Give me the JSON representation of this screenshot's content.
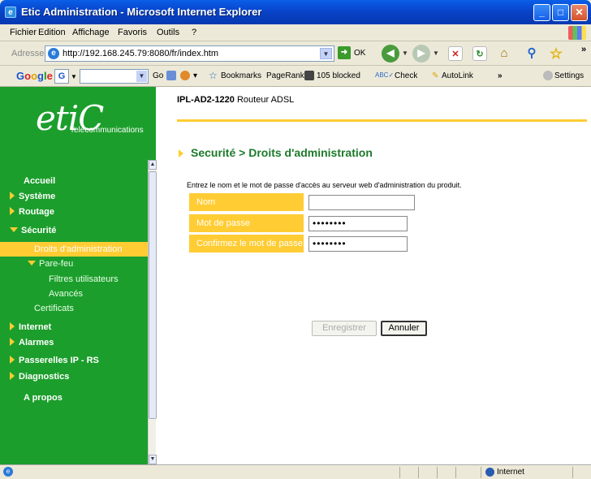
{
  "window": {
    "title": "Etic Administration - Microsoft Internet Explorer"
  },
  "menu": [
    "Fichier",
    "Edition",
    "Affichage",
    "Favoris",
    "Outils",
    "?"
  ],
  "address": {
    "label": "Adresse",
    "url": "http://192.168.245.79:8080/fr/index.htm",
    "go_label": "OK"
  },
  "google_toolbar": {
    "go_label": "Go",
    "bookmarks": "Bookmarks",
    "pagerank": "PageRank",
    "blocked": "105 blocked",
    "check": "Check",
    "autolink": "AutoLink",
    "settings": "Settings"
  },
  "logo": {
    "brand": "etiC",
    "subtitle": "Telecommunications"
  },
  "sidebar": {
    "items": [
      {
        "label": "Accueil",
        "level": 0,
        "marker": "none"
      },
      {
        "label": "Système",
        "level": 0,
        "marker": "right"
      },
      {
        "label": "Routage",
        "level": 0,
        "marker": "right"
      },
      {
        "label": "Sécurité",
        "level": 0,
        "marker": "down"
      },
      {
        "label": "Droits d'administration",
        "level": 1,
        "marker": "none",
        "active": true
      },
      {
        "label": "Pare-feu",
        "level": 1,
        "marker": "down"
      },
      {
        "label": "Filtres utilisateurs",
        "level": 2,
        "marker": "none"
      },
      {
        "label": "Avancés",
        "level": 2,
        "marker": "none"
      },
      {
        "label": "Certificats",
        "level": 1,
        "marker": "none"
      },
      {
        "label": "Internet",
        "level": 0,
        "marker": "right"
      },
      {
        "label": "Alarmes",
        "level": 0,
        "marker": "right"
      },
      {
        "label": "Passerelles IP - RS",
        "level": 0,
        "marker": "right"
      },
      {
        "label": "Diagnostics",
        "level": 0,
        "marker": "right"
      },
      {
        "label": "A propos",
        "level": 0,
        "marker": "none"
      }
    ]
  },
  "header": {
    "model": "IPL-AD2-1220",
    "model_desc": "Routeur ADSL"
  },
  "page": {
    "breadcrumb": "Securité > Droits d'administration",
    "instructions": "Entrez le nom et le mot de passe d'accès au serveur web d'administration du produit.",
    "fields": [
      {
        "label": "Nom",
        "value": ""
      },
      {
        "label": "Mot de passe",
        "value": "••••••••"
      },
      {
        "label": "Confirmez le mot de passe",
        "value": "••••••••"
      }
    ],
    "save_label": "Enregistrer",
    "cancel_label": "Annuler"
  },
  "status": {
    "zone": "Internet"
  }
}
